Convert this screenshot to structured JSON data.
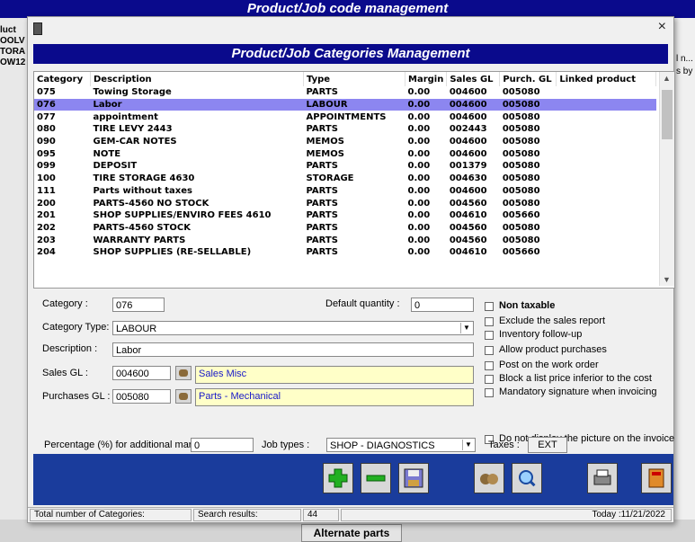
{
  "app": {
    "outer_title": "Product/Job code management",
    "left_partial": [
      "luct",
      "OOLV",
      "TORA",
      "OW12"
    ],
    "right_partial": [
      "l n...",
      "s by"
    ],
    "alternate_parts": "Alternate parts"
  },
  "dialog": {
    "title": "Product/Job Categories Management",
    "close": "×"
  },
  "grid": {
    "columns": [
      "Category",
      "Description",
      "Type",
      "Margin",
      "Sales GL",
      "Purch. GL",
      "Linked product"
    ],
    "rows": [
      [
        "075",
        "Towing Storage",
        "PARTS",
        "0.00",
        "004600",
        "005080",
        ""
      ],
      [
        "076",
        "Labor",
        "LABOUR",
        "0.00",
        "004600",
        "005080",
        ""
      ],
      [
        "077",
        "appointment",
        "APPOINTMENTS",
        "0.00",
        "004600",
        "005080",
        ""
      ],
      [
        "080",
        "TIRE LEVY 2443",
        "PARTS",
        "0.00",
        "002443",
        "005080",
        ""
      ],
      [
        "090",
        "GEM-CAR NOTES",
        "MEMOS",
        "0.00",
        "004600",
        "005080",
        ""
      ],
      [
        "095",
        "NOTE",
        "MEMOS",
        "0.00",
        "004600",
        "005080",
        ""
      ],
      [
        "099",
        "DEPOSIT",
        "PARTS",
        "0.00",
        "001379",
        "005080",
        ""
      ],
      [
        "100",
        "TIRE STORAGE 4630",
        "STORAGE",
        "0.00",
        "004630",
        "005080",
        ""
      ],
      [
        "111",
        "Parts without taxes",
        "PARTS",
        "0.00",
        "004600",
        "005080",
        ""
      ],
      [
        "200",
        "PARTS-4560 NO STOCK",
        "PARTS",
        "0.00",
        "004560",
        "005080",
        ""
      ],
      [
        "201",
        "SHOP SUPPLIES/ENVIRO FEES 4610",
        "PARTS",
        "0.00",
        "004610",
        "005660",
        ""
      ],
      [
        "202",
        "PARTS-4560 STOCK",
        "PARTS",
        "0.00",
        "004560",
        "005080",
        ""
      ],
      [
        "203",
        "WARRANTY PARTS",
        "PARTS",
        "0.00",
        "004560",
        "005080",
        ""
      ],
      [
        "204",
        "SHOP SUPPLIES (RE-SELLABLE)",
        "PARTS",
        "0.00",
        "004610",
        "005660",
        ""
      ]
    ],
    "selected_index": 1
  },
  "form": {
    "category_label": "Category :",
    "category_value": "076",
    "default_qty_label": "Default quantity :",
    "default_qty_value": "0",
    "type_label": "Category Type:",
    "type_value": "LABOUR",
    "desc_label": "Description :",
    "desc_value": "Labor",
    "sales_gl_label": "Sales GL :",
    "sales_gl_value": "004600",
    "sales_gl_name": "Sales Misc",
    "purch_gl_label": "Purchases GL :",
    "purch_gl_value": "005080",
    "purch_gl_name": "Parts - Mechanical",
    "margin_label": "Percentage (%) for additional margin :",
    "margin_value": "0",
    "job_types_label": "Job types :",
    "job_types_value": "SHOP - DIAGNOSTICS",
    "taxes_label": "Taxes :",
    "taxes_value": "EXT",
    "checks": {
      "non_taxable": "Non taxable",
      "exclude_sales": "Exclude the sales report",
      "inventory": "Inventory follow-up",
      "allow_purchases": "Allow product purchases",
      "post_work_order": "Post on the work order",
      "block_list_price": "Block a list price inferior to the cost",
      "mandatory_signature": "Mandatory signature when invoicing",
      "no_picture": "Do not display the picture on the invoice"
    }
  },
  "status": {
    "total_label": "Total number of Categories:",
    "search_label": "Search results:",
    "count": "44",
    "today": "Today :11/21/2022"
  },
  "colors": {
    "title_bar": "#0a0a8c",
    "selection": "#8c86f0",
    "button_bar": "#1a3c9c",
    "gl_name_bg": "#ffffc8"
  }
}
